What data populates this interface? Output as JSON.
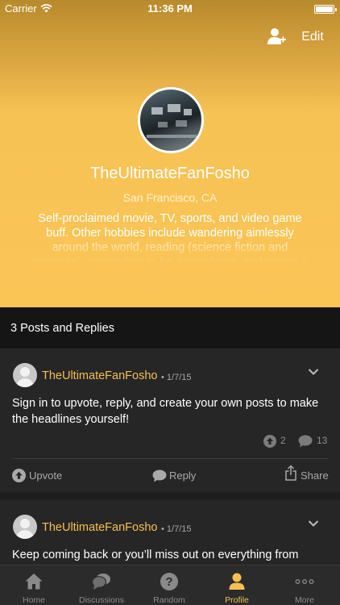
{
  "status_bar": {
    "carrier": "Carrier",
    "time": "11:36 PM"
  },
  "header": {
    "edit_label": "Edit"
  },
  "profile": {
    "username": "TheUltimateFanFosho",
    "location": "San Francisco, CA",
    "bio": "Self-proclaimed movie, TV, sports, and video game buff. Other hobbies include wandering aimlessly around the world, reading (science fiction and memoirs), pretending to be a misobsort, and eating a ridiculous"
  },
  "posts_section": {
    "title": "3 Posts and Replies"
  },
  "posts": [
    {
      "author": "TheUltimateFanFosho",
      "date": "• 1/7/15",
      "body": "Sign in to upvote, reply, and create your own posts to make the headlines yourself!",
      "upvote_count": "2",
      "comment_count": "13",
      "upvote_label": "Upvote",
      "reply_label": "Reply",
      "share_label": "Share"
    },
    {
      "author": "TheUltimateFanFosho",
      "date": "• 1/7/15",
      "body": "Keep coming back or you’ll miss out on everything from"
    }
  ],
  "tabbar": {
    "items": [
      {
        "label": "Home",
        "icon": "home-icon"
      },
      {
        "label": "Discussions",
        "icon": "discussions-icon"
      },
      {
        "label": "Random",
        "icon": "question-icon"
      },
      {
        "label": "Profile",
        "icon": "profile-icon",
        "active": true
      },
      {
        "label": "More",
        "icon": "more-icon"
      }
    ]
  },
  "colors": {
    "accent": "#f4c052",
    "header_bg": "#fbc556",
    "card_bg": "#262626",
    "section_bg": "#151515"
  }
}
